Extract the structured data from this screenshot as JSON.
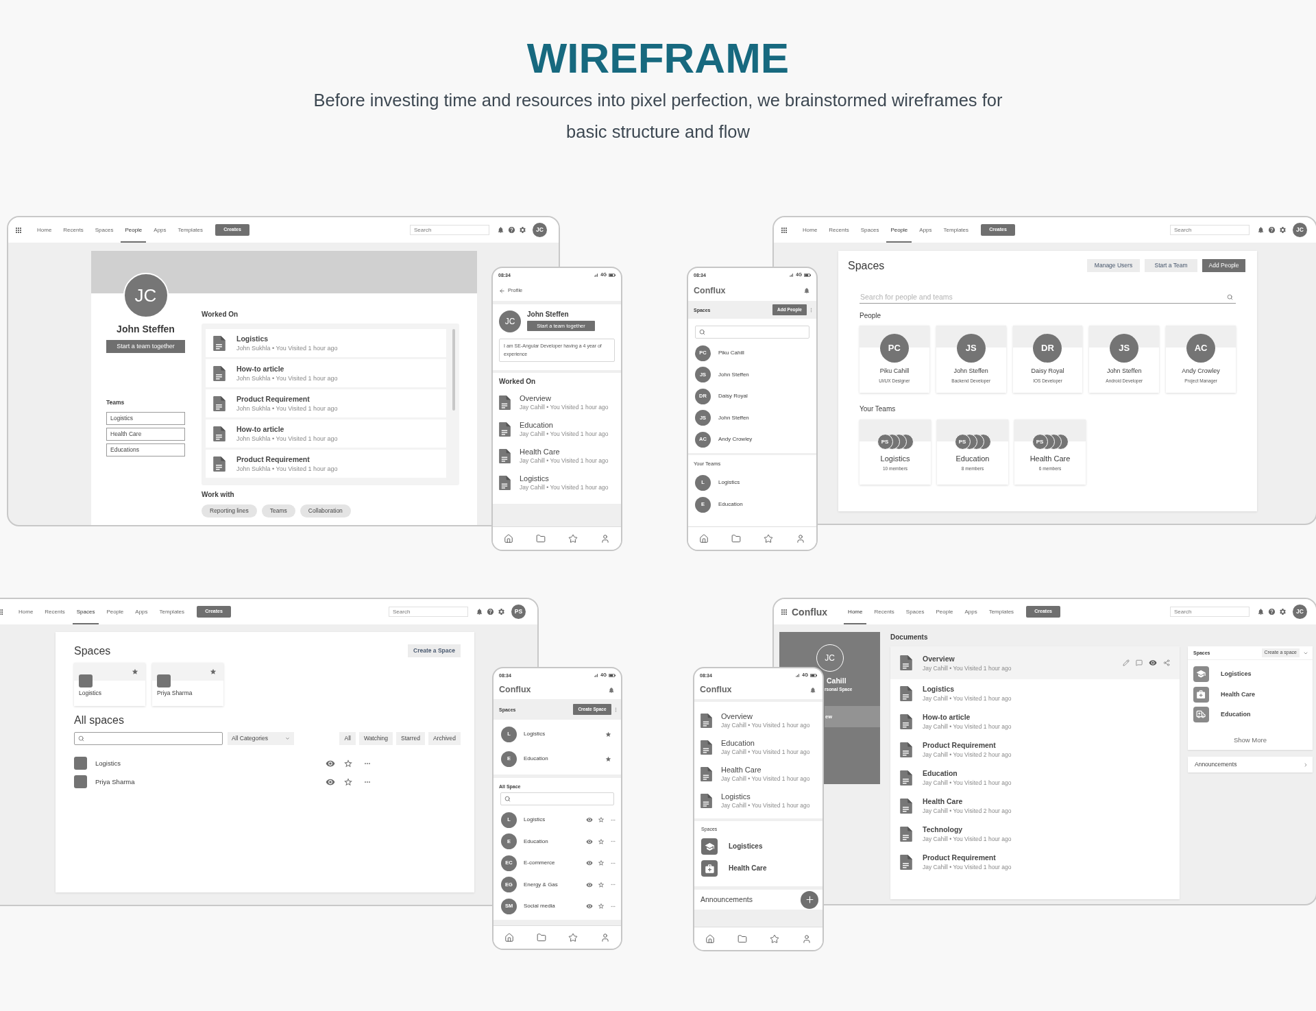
{
  "header": {
    "title": "WIREFRAME",
    "subtitle": "Before investing time and resources into pixel perfection, we brainstormed wireframes for basic structure and flow"
  },
  "profile_desktop": {
    "nav": {
      "items": [
        {
          "label": "Home",
          "selected": false
        },
        {
          "label": "Recents",
          "selected": false
        },
        {
          "label": "Spaces",
          "selected": false
        },
        {
          "label": "People",
          "selected": true
        },
        {
          "label": "Apps",
          "selected": false
        },
        {
          "label": "Templates",
          "selected": false
        }
      ],
      "create_button": "Creates",
      "search": {
        "placeholder": "Search"
      },
      "avatar": "JC"
    },
    "avatar": "JC",
    "name": "John Steffen",
    "team_button": "Start a team together",
    "teams_label": "Teams",
    "teams": [
      "Logistics",
      "Health Care",
      "Educations"
    ],
    "worked_on_label": "Worked On",
    "documents": [
      {
        "title": "Logistics",
        "meta": "John Sukhla • You Visited 1 hour ago"
      },
      {
        "title": "How-to article",
        "meta": "John Sukhla • You Visited 1 hour ago"
      },
      {
        "title": "Product Requirement",
        "meta": "John Sukhla • You Visited 1 hour ago"
      },
      {
        "title": "How-to article",
        "meta": "John Sukhla • You Visited 1 hour ago"
      },
      {
        "title": "Product Requirement",
        "meta": "John Sukhla • You Visited 1 hour ago"
      }
    ],
    "work_with_label": "Work with",
    "work_with": [
      "Reporting lines",
      "Teams",
      "Collaboration"
    ]
  },
  "profile_phone": {
    "status": {
      "time": "08:34",
      "network": "4G"
    },
    "back_label": "Profile",
    "avatar": "JC",
    "name": "John Steffen",
    "team_button": "Start a team together",
    "bio": "I am SE-Angular Developer having a 4 year of experience",
    "worked_on_label": "Worked On",
    "documents": [
      {
        "title": "Overview",
        "meta": "Jay Cahill • You Visited 1 hour ago"
      },
      {
        "title": "Education",
        "meta": "Jay Cahill • You Visited 1 hour ago"
      },
      {
        "title": "Health Care",
        "meta": "Jay Cahill • You Visited 1 hour ago"
      },
      {
        "title": "Logistics",
        "meta": "Jay Cahill • You Visited 1 hour ago"
      }
    ]
  },
  "people_phone": {
    "status": {
      "time": "08:34",
      "network": "4G"
    },
    "brand": "Conflux",
    "section_label": "Spaces",
    "add_button": "Add People",
    "people": [
      {
        "initials": "PC",
        "name": "Piku Cahill"
      },
      {
        "initials": "JS",
        "name": "John Steffen"
      },
      {
        "initials": "DR",
        "name": "Daisy Royal"
      },
      {
        "initials": "JS",
        "name": "John Steffen"
      },
      {
        "initials": "AC",
        "name": "Andy Crowley"
      }
    ],
    "teams_label": "Your Teams",
    "teams": [
      {
        "initials": "L",
        "name": "Logistics"
      },
      {
        "initials": "E",
        "name": "Education"
      }
    ]
  },
  "people_desktop": {
    "nav": {
      "items": [
        {
          "label": "Home",
          "selected": false
        },
        {
          "label": "Recents",
          "selected": false
        },
        {
          "label": "Spaces",
          "selected": false
        },
        {
          "label": "People",
          "selected": true
        },
        {
          "label": "Apps",
          "selected": false
        },
        {
          "label": "Templates",
          "selected": false
        }
      ],
      "create_button": "Creates",
      "search": {
        "placeholder": "Search"
      },
      "avatar": "JC"
    },
    "title": "Spaces",
    "buttons": [
      {
        "label": "Manage Users",
        "kind": "secondary"
      },
      {
        "label": "Start a Team",
        "kind": "secondary"
      },
      {
        "label": "Add People",
        "kind": "primary"
      }
    ],
    "search": {
      "placeholder": "Search for people and teams"
    },
    "people_label": "People",
    "people": [
      {
        "initials": "PC",
        "name": "Piku Cahill",
        "role": "UI/UX Designer"
      },
      {
        "initials": "JS",
        "name": "John Steffen",
        "role": "Backend Developer"
      },
      {
        "initials": "DR",
        "name": "Daisy Royal",
        "role": "IOS Developer"
      },
      {
        "initials": "JS",
        "name": "John Steffen",
        "role": "Android Developer"
      },
      {
        "initials": "AC",
        "name": "Andy Crowley",
        "role": "Project Manager"
      }
    ],
    "teams_label": "Your Teams",
    "teams": [
      {
        "avatar": "PS",
        "name": "Logistics",
        "members": "10 members"
      },
      {
        "avatar": "PS",
        "name": "Education",
        "members": "8 members"
      },
      {
        "avatar": "PS",
        "name": "Health Care",
        "members": "6 members"
      }
    ]
  },
  "spaces_desktop": {
    "nav": {
      "items": [
        {
          "label": "Home",
          "selected": false
        },
        {
          "label": "Recents",
          "selected": false
        },
        {
          "label": "Spaces",
          "selected": true
        },
        {
          "label": "People",
          "selected": false
        },
        {
          "label": "Apps",
          "selected": false
        },
        {
          "label": "Templates",
          "selected": false
        }
      ],
      "create_button": "Creates",
      "search": {
        "placeholder": "Search"
      },
      "avatar": "PS"
    },
    "title": "Spaces",
    "create_button": "Create a Space",
    "starred": [
      {
        "name": "Logistics",
        "starred": true
      },
      {
        "name": "Priya Sharma",
        "starred": true
      }
    ],
    "all_label": "All spaces",
    "category": "All Categories",
    "filters": [
      "All",
      "Watching",
      "Starred",
      "Archived"
    ],
    "spaces": [
      {
        "name": "Logistics",
        "starred": false
      },
      {
        "name": "Priya Sharma",
        "starred": false
      }
    ]
  },
  "spaces_phone": {
    "status": {
      "time": "08:34",
      "network": "4G"
    },
    "brand": "Conflux",
    "section_label": "Spaces",
    "create_button": "Create Space",
    "starred": [
      {
        "initials": "L",
        "name": "Logistics",
        "starred": true
      },
      {
        "initials": "E",
        "name": "Education",
        "starred": true
      }
    ],
    "all_label": "All Space",
    "spaces": [
      {
        "initials": "L",
        "name": "Logistics",
        "starred": false
      },
      {
        "initials": "E",
        "name": "Education",
        "starred": false
      },
      {
        "initials": "EC",
        "name": "E-commerce",
        "starred": false
      },
      {
        "initials": "EG",
        "name": "Energy & Gas",
        "starred": false
      },
      {
        "initials": "SM",
        "name": "Social media",
        "starred": false
      }
    ]
  },
  "home_phone": {
    "status": {
      "time": "08:34",
      "network": "4G"
    },
    "brand": "Conflux",
    "documents": [
      {
        "title": "Overview",
        "meta": "Jay Cahill • You Visited 1 hour ago"
      },
      {
        "title": "Education",
        "meta": "Jay Cahill • You Visited 1 hour ago"
      },
      {
        "title": "Health Care",
        "meta": "Jay Cahill • You Visited 1 hour ago"
      },
      {
        "title": "Logistics",
        "meta": "Jay Cahill • You Visited 1 hour ago"
      }
    ],
    "spaces_label": "Spaces",
    "spaces": [
      {
        "name": "Logistices",
        "kind": "graduation"
      },
      {
        "name": "Health Care",
        "kind": "medical"
      }
    ],
    "announcements": "Announcements"
  },
  "home_desktop": {
    "nav": {
      "brand": "Conflux",
      "items": [
        {
          "label": "Home",
          "selected": true
        },
        {
          "label": "Recents",
          "selected": false
        },
        {
          "label": "Spaces",
          "selected": false
        },
        {
          "label": "People",
          "selected": false
        },
        {
          "label": "Apps",
          "selected": false
        },
        {
          "label": "Templates",
          "selected": false
        }
      ],
      "create_button": "Creates",
      "search": {
        "placeholder": "Search"
      },
      "avatar": "JC"
    },
    "sidebar": {
      "avatar": "JC",
      "name": "Cahill",
      "subtitle": "rsonal Space",
      "items": [
        {
          "label": "ew",
          "selected": true
        }
      ]
    },
    "documents_label": "Documents",
    "documents": [
      {
        "title": "Overview",
        "meta": "Jay Cahill • You Visited 1 hour ago",
        "selected": true
      },
      {
        "title": "Logistics",
        "meta": "Jay Cahill • You Visited 1 hour ago",
        "selected": false
      },
      {
        "title": "How-to article",
        "meta": "Jay Cahill • You Visited 1 hour ago",
        "selected": false
      },
      {
        "title": "Product Requirement",
        "meta": "Jay Cahill • You Visited 2 hour ago",
        "selected": false
      },
      {
        "title": "Education",
        "meta": "Jay Cahill • You Visited 1 hour ago",
        "selected": false
      },
      {
        "title": "Health Care",
        "meta": "Jay Cahill • You Visited 2 hour ago",
        "selected": false
      },
      {
        "title": "Technology",
        "meta": "Jay Cahill • You Visited 1 hour ago",
        "selected": false
      },
      {
        "title": "Product Requirement",
        "meta": "Jay Cahill • You Visited 1 hour ago",
        "selected": false
      }
    ],
    "spaces_panel": {
      "title": "Spaces",
      "create_button": "Create a space",
      "items": [
        {
          "name": "Logistices",
          "kind": "graduation"
        },
        {
          "name": "Health Care",
          "kind": "medical"
        },
        {
          "name": "Education",
          "kind": "ambulance"
        }
      ],
      "show_more": "Show More"
    },
    "announcements": "Announcements"
  }
}
